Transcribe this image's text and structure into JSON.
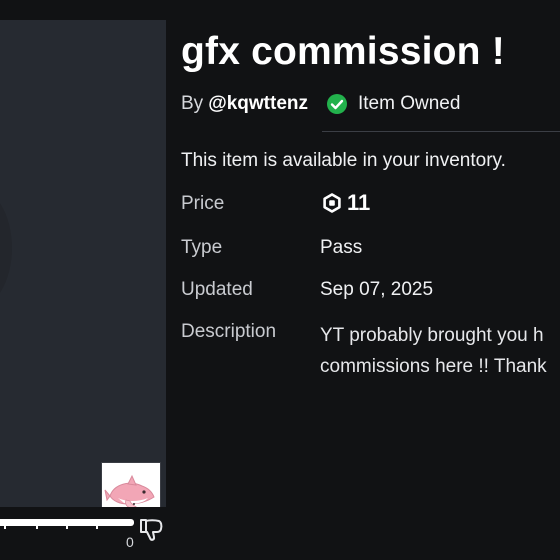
{
  "item": {
    "title": "gfx commission !",
    "by_label": "By",
    "creator": "@kqwttenz",
    "owned_label": "Item Owned",
    "notice": "This item is available in your inventory."
  },
  "details": {
    "price_label": "Price",
    "price_value": "11",
    "type_label": "Type",
    "type_value": "Pass",
    "updated_label": "Updated",
    "updated_value": "Sep 07, 2025",
    "description_label": "Description",
    "description_line1": "YT probably brought you h",
    "description_line2": "commissions here !! Thank"
  },
  "votes": {
    "dislike_count": "0",
    "like_fraction": 1.0
  },
  "icons": {
    "owned": "check-circle-icon",
    "currency": "robux-icon",
    "dislike": "thumbs-down-icon"
  },
  "colors": {
    "owned_green": "#22b14c",
    "background": "#111214",
    "panel": "#262a31"
  }
}
